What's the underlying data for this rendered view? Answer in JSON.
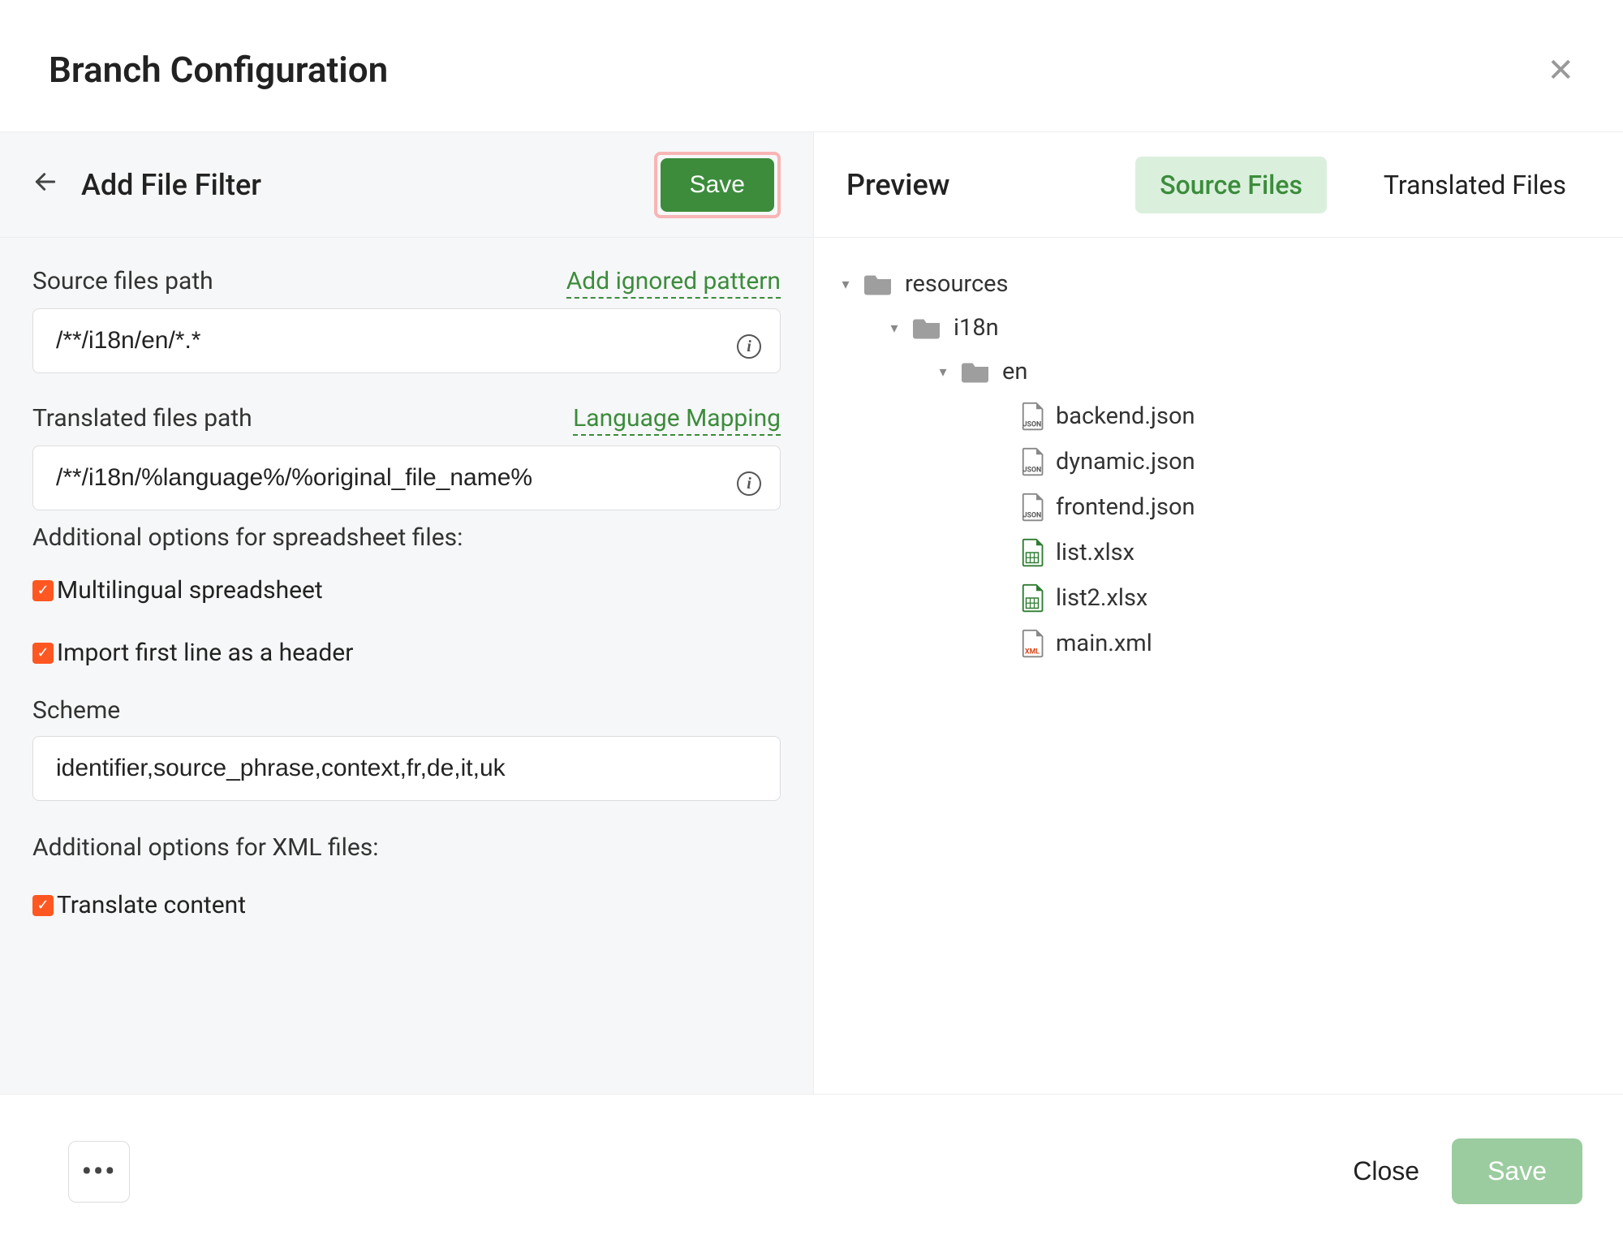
{
  "modal": {
    "title": "Branch Configuration"
  },
  "left": {
    "title": "Add File Filter",
    "save": "Save",
    "sourceLabel": "Source files path",
    "addIgnored": "Add ignored pattern",
    "sourceValue": "/**/i18n/en/*.*",
    "translatedLabel": "Translated files path",
    "langMapping": "Language Mapping",
    "translatedValue": "/**/i18n/%language%/%original_file_name%",
    "spreadsheetOptions": "Additional options for spreadsheet files:",
    "cbMultilingual": "Multilingual spreadsheet",
    "cbFirstLine": "Import first line as a header",
    "schemeLabel": "Scheme",
    "schemeValue": "identifier,source_phrase,context,fr,de,it,uk",
    "xmlOptions": "Additional options for XML files:",
    "cbTranslateContent": "Translate content"
  },
  "right": {
    "preview": "Preview",
    "tabSource": "Source Files",
    "tabTranslated": "Translated Files",
    "tree": {
      "root": "resources",
      "lvl1": "i18n",
      "lvl2": "en",
      "files": [
        "backend.json",
        "dynamic.json",
        "frontend.json",
        "list.xlsx",
        "list2.xlsx",
        "main.xml"
      ]
    }
  },
  "footer": {
    "close": "Close",
    "save": "Save"
  }
}
